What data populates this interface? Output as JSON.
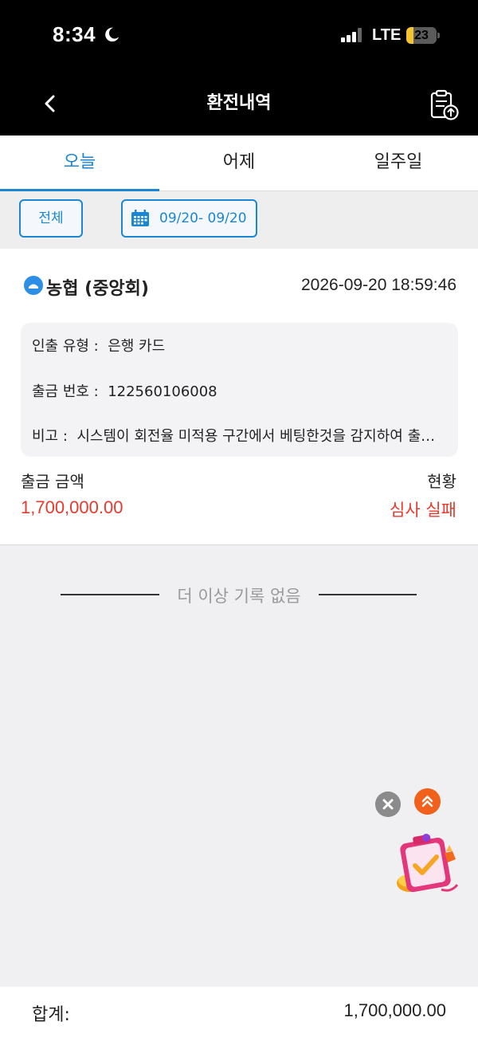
{
  "status_bar": {
    "time": "8:34",
    "network": "LTE",
    "battery": "23",
    "battery_level": 0.23,
    "battery_color": "#f5c531"
  },
  "nav": {
    "title": "환전내역",
    "back_icon": "chevron-left-icon",
    "export_icon": "clipboard-upload-icon"
  },
  "tabs": [
    {
      "label": "오늘",
      "active": true
    },
    {
      "label": "어제",
      "active": false
    },
    {
      "label": "일주일",
      "active": false
    }
  ],
  "filters": {
    "all_label": "전체",
    "date_range": "09/20- 09/20",
    "date_icon": "calendar-icon"
  },
  "record": {
    "bank_name": "농협 (중앙회)",
    "datetime": "2026-09-20 18:59:46",
    "withdraw_type_label": "인출 유형 :",
    "withdraw_type_value": "은행 카드",
    "withdraw_no_label": "출금 번호 :",
    "withdraw_no_value": "122560106008",
    "remark_label": "비고 :",
    "remark_value": "시스템이 회전율 미적용 구간에서 베팅한것을 감지하여 출금이 거절되었습니다",
    "amount_label": "출금 금액",
    "amount_value": "1,700,000.00",
    "status_label": "현황",
    "status_value": "심사 실패"
  },
  "list_end": {
    "text": "더 이상 기록 없음"
  },
  "footer": {
    "total_label": "합계:",
    "total_value": "1,700,000.00"
  },
  "colors": {
    "accent": "#1a86d4",
    "error": "#e63a2c",
    "fab_orange": "#f2611b"
  }
}
